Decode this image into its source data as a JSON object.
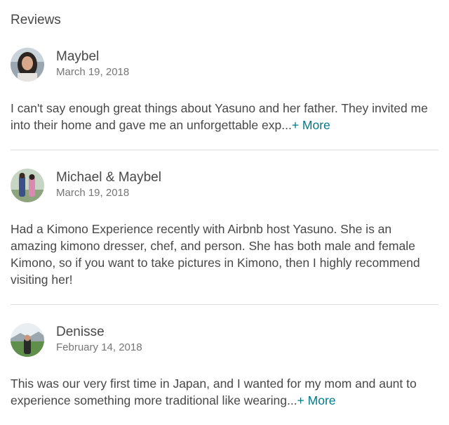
{
  "section": {
    "title": "Reviews"
  },
  "reviews": [
    {
      "name": "Maybel",
      "date": "March 19, 2018",
      "text": "I can't say enough great things about Yasuno and her father. They invited me into their home and gave me an unforgettable exp...",
      "more_label": "+ More"
    },
    {
      "name": "Michael & Maybel",
      "date": "March 19, 2018",
      "text": "Had a Kimono Experience recently with Airbnb host Yasuno. She is an amazing kimono dresser, chef, and person. She has both male and female Kimono, so if you want to take pictures in Kimono, then I highly recommend visiting her!",
      "more_label": ""
    },
    {
      "name": "Denisse",
      "date": "February 14, 2018",
      "text": "This was our very first time in Japan, and I wanted for my mom and aunt to experience something more traditional like wearing...",
      "more_label": "+ More"
    }
  ],
  "colors": {
    "text": "#484848",
    "muted": "#767676",
    "link": "#007a87",
    "divider": "#dcdcdc"
  }
}
